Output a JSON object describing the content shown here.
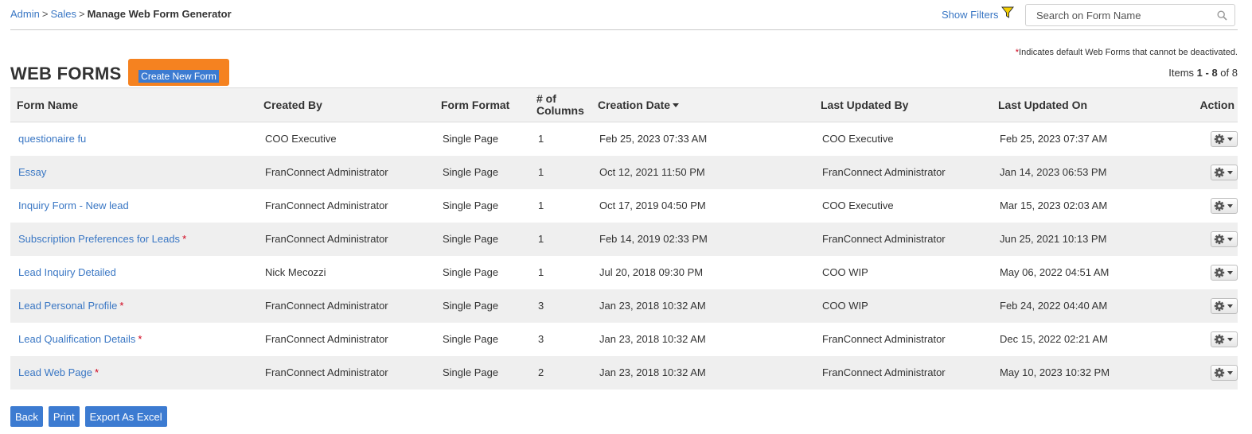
{
  "breadcrumb": {
    "items": [
      "Admin",
      "Sales"
    ],
    "separator": ">",
    "current": "Manage Web Form Generator"
  },
  "filters": {
    "show_filters_label": "Show Filters",
    "icon": "filter-icon"
  },
  "search": {
    "placeholder": "Search on Form Name",
    "icon": "search-icon"
  },
  "note": {
    "star": "*",
    "text": "Indicates default Web Forms that cannot be deactivated."
  },
  "page_title": "WEB FORMS",
  "create_button_label": "Create New Form",
  "pagination": {
    "prefix": "Items",
    "range": "1 - 8",
    "of_label": "of",
    "total": "8"
  },
  "table": {
    "columns": {
      "form_name": "Form Name",
      "created_by": "Created By",
      "form_format": "Form Format",
      "columns_line1": "# of",
      "columns_line2": "Columns",
      "creation_date": "Creation Date",
      "last_updated_by": "Last Updated By",
      "last_updated_on": "Last Updated On",
      "action": "Action"
    },
    "rows": [
      {
        "form_name": "questionaire fu",
        "required": "",
        "created_by": "COO Executive",
        "form_format": "Single Page",
        "num_columns": "1",
        "creation_date": "Feb 25, 2023 07:33 AM",
        "last_updated_by": "COO Executive",
        "last_updated_on": "Feb 25, 2023 07:37 AM"
      },
      {
        "form_name": "Essay",
        "required": "",
        "created_by": "FranConnect Administrator",
        "form_format": "Single Page",
        "num_columns": "1",
        "creation_date": "Oct 12, 2021 11:50 PM",
        "last_updated_by": "FranConnect Administrator",
        "last_updated_on": "Jan 14, 2023 06:53 PM"
      },
      {
        "form_name": "Inquiry Form - New lead",
        "required": "",
        "created_by": "FranConnect Administrator",
        "form_format": "Single Page",
        "num_columns": "1",
        "creation_date": "Oct 17, 2019 04:50 PM",
        "last_updated_by": "COO Executive",
        "last_updated_on": "Mar 15, 2023 02:03 AM"
      },
      {
        "form_name": "Subscription Preferences for Leads",
        "required": "*",
        "created_by": "FranConnect Administrator",
        "form_format": "Single Page",
        "num_columns": "1",
        "creation_date": "Feb 14, 2019 02:33 PM",
        "last_updated_by": "FranConnect Administrator",
        "last_updated_on": "Jun 25, 2021 10:13 PM"
      },
      {
        "form_name": "Lead Inquiry Detailed",
        "required": "",
        "created_by": "Nick Mecozzi",
        "form_format": "Single Page",
        "num_columns": "1",
        "creation_date": "Jul 20, 2018 09:30 PM",
        "last_updated_by": "COO WIP",
        "last_updated_on": "May 06, 2022 04:51 AM"
      },
      {
        "form_name": "Lead Personal Profile",
        "required": "*",
        "created_by": "FranConnect Administrator",
        "form_format": "Single Page",
        "num_columns": "3",
        "creation_date": "Jan 23, 2018 10:32 AM",
        "last_updated_by": "COO WIP",
        "last_updated_on": "Feb 24, 2022 04:40 AM"
      },
      {
        "form_name": "Lead Qualification Details",
        "required": "*",
        "created_by": "FranConnect Administrator",
        "form_format": "Single Page",
        "num_columns": "3",
        "creation_date": "Jan 23, 2018 10:32 AM",
        "last_updated_by": "FranConnect Administrator",
        "last_updated_on": "Dec 15, 2022 02:21 AM"
      },
      {
        "form_name": "Lead Web Page",
        "required": "*",
        "created_by": "FranConnect Administrator",
        "form_format": "Single Page",
        "num_columns": "2",
        "creation_date": "Jan 23, 2018 10:32 AM",
        "last_updated_by": "FranConnect Administrator",
        "last_updated_on": "May 10, 2023 10:32 PM"
      }
    ]
  },
  "footer": {
    "back_label": "Back",
    "print_label": "Print",
    "export_label": "Export As Excel"
  },
  "colors": {
    "link": "#3a77c4",
    "accent_orange": "#f58220",
    "button_blue": "#3c7bd1",
    "required_red": "#d0021b",
    "row_alt": "#efefef"
  }
}
